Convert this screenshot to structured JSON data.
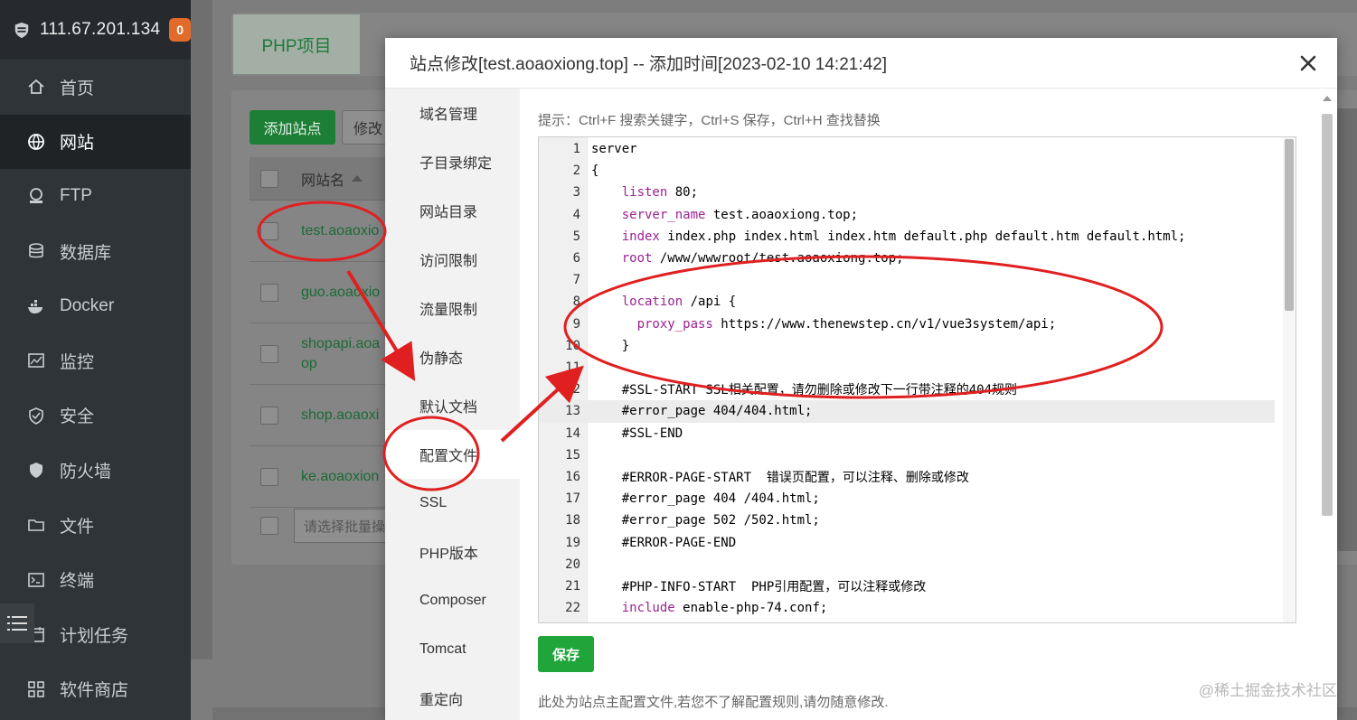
{
  "sidebar": {
    "server_ip": "111.67.201.134",
    "badge_count": "0",
    "items": [
      {
        "label": "首页",
        "icon": "home-icon"
      },
      {
        "label": "网站",
        "icon": "globe-icon",
        "active": true
      },
      {
        "label": "FTP",
        "icon": "ftp-icon"
      },
      {
        "label": "数据库",
        "icon": "database-icon"
      },
      {
        "label": "Docker",
        "icon": "docker-icon"
      },
      {
        "label": "监控",
        "icon": "monitor-icon"
      },
      {
        "label": "安全",
        "icon": "shield-check-icon"
      },
      {
        "label": "防火墙",
        "icon": "firewall-shield-icon"
      },
      {
        "label": "文件",
        "icon": "folder-icon"
      },
      {
        "label": "终端",
        "icon": "terminal-icon"
      },
      {
        "label": "计划任务",
        "icon": "calendar-icon"
      },
      {
        "label": "软件商店",
        "icon": "apps-icon"
      }
    ]
  },
  "background": {
    "tab_label": "PHP项目",
    "add_site_button": "添加站点",
    "modify_button": "修改",
    "column_header": "网站名",
    "sites": [
      "test.aoaoxio",
      "guo.aoaoxio",
      "shopapi.aoa\nop",
      "shop.aoaoxi",
      "ke.aoaoxion"
    ],
    "batch_placeholder": "请选择批量操"
  },
  "dialog": {
    "title": "站点修改[test.aoaoxiong.top] -- 添加时间[2023-02-10 14:21:42]",
    "tabs": [
      "域名管理",
      "子目录绑定",
      "网站目录",
      "访问限制",
      "流量限制",
      "伪静态",
      "默认文档",
      "配置文件",
      "SSL",
      "PHP版本",
      "Composer",
      "Tomcat",
      "重定向"
    ],
    "active_tab": "配置文件",
    "tip": "提示：Ctrl+F 搜索关键字，Ctrl+S 保存，Ctrl+H 查找替换",
    "save_button": "保存",
    "note": "此处为站点主配置文件,若您不了解配置规则,请勿随意修改.",
    "highlighted_line": 13,
    "code_lines": [
      "server",
      "{",
      "    listen 80;",
      "    server_name test.aoaoxiong.top;",
      "    index index.php index.html index.htm default.php default.htm default.html;",
      "    root /www/wwwroot/test.aoaoxiong.top;",
      "",
      "    location /api {",
      "      proxy_pass https://www.thenewstep.cn/v1/vue3system/api;",
      "    }",
      "",
      "    #SSL-START SSL相关配置，请勿删除或修改下一行带注释的404规则",
      "    #error_page 404/404.html;",
      "    #SSL-END",
      "",
      "    #ERROR-PAGE-START  错误页配置，可以注释、删除或修改",
      "    #error_page 404 /404.html;",
      "    #error_page 502 /502.html;",
      "    #ERROR-PAGE-END",
      "",
      "    #PHP-INFO-START  PHP引用配置，可以注释或修改",
      "    include enable-php-74.conf;"
    ]
  },
  "watermark": "@稀土掘金技术社区",
  "colors": {
    "accent": "#20a53a",
    "annotation": "#e02020",
    "sidebar": "#2f3439"
  }
}
